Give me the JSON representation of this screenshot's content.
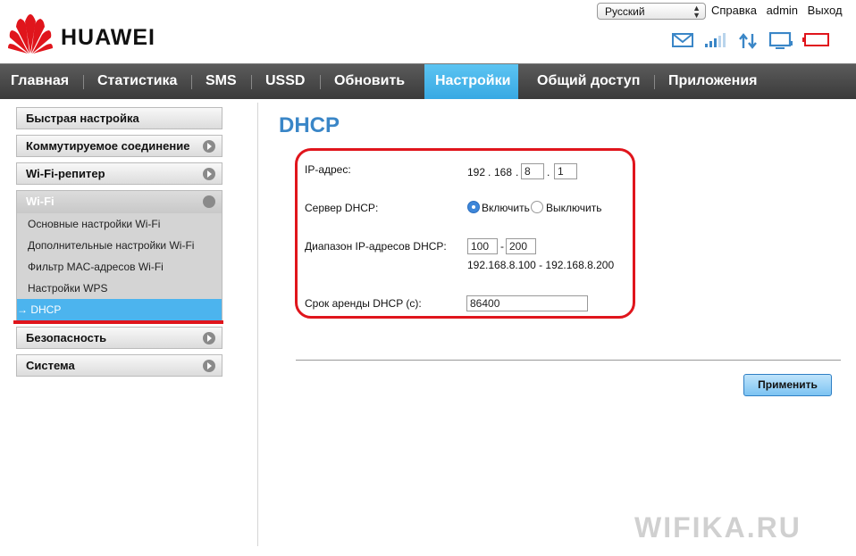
{
  "header": {
    "brand": "HUAWEI",
    "language": "Русский",
    "links": [
      "Справка",
      "admin",
      "Выход"
    ],
    "status_icons": [
      "mail-icon",
      "signal-icon",
      "updown-arrows-icon",
      "monitor-icon",
      "battery-icon"
    ]
  },
  "nav": {
    "items": [
      "Главная",
      "Статистика",
      "SMS",
      "USSD",
      "Обновить",
      "Настройки",
      "Общий доступ",
      "Приложения"
    ],
    "active": "Настройки"
  },
  "sidebar": {
    "quick_setup": "Быстрая настройка",
    "dialup": "Коммутируемое соединение",
    "wifi_repeater": "Wi-Fi-репитер",
    "wifi": "Wi-Fi",
    "wifi_items": [
      "Основные настройки Wi-Fi",
      "Дополнительные настройки Wi-Fi",
      "Фильтр MAC-адресов Wi-Fi",
      "Настройки WPS",
      "DHCP"
    ],
    "wifi_active_prefix": "→",
    "security": "Безопасность",
    "system": "Система"
  },
  "content": {
    "title": "DHCP",
    "ip_label": "IP-адрес:",
    "ip_part1": "192",
    "ip_dot": ".",
    "ip_part2": "168",
    "ip_part3": "8",
    "ip_part4": "1",
    "dhcp_server_label": "Сервер DHCP:",
    "enable_label": "Включить",
    "disable_label": "Выключить",
    "range_label": "Диапазон IP-адресов DHCP:",
    "range_start": "100",
    "range_dash": "-",
    "range_end": "200",
    "range_text": "192.168.8.100 - 192.168.8.200",
    "lease_label": "Срок аренды DHCP (с):",
    "lease_value": "86400",
    "apply_label": "Применить"
  },
  "watermark": "WIFIKA.RU",
  "colors": {
    "accent": "#3a86c7",
    "nav_active": "#4cb4ee",
    "highlight_red": "#e0151c",
    "brand_red": "#e0151c"
  }
}
